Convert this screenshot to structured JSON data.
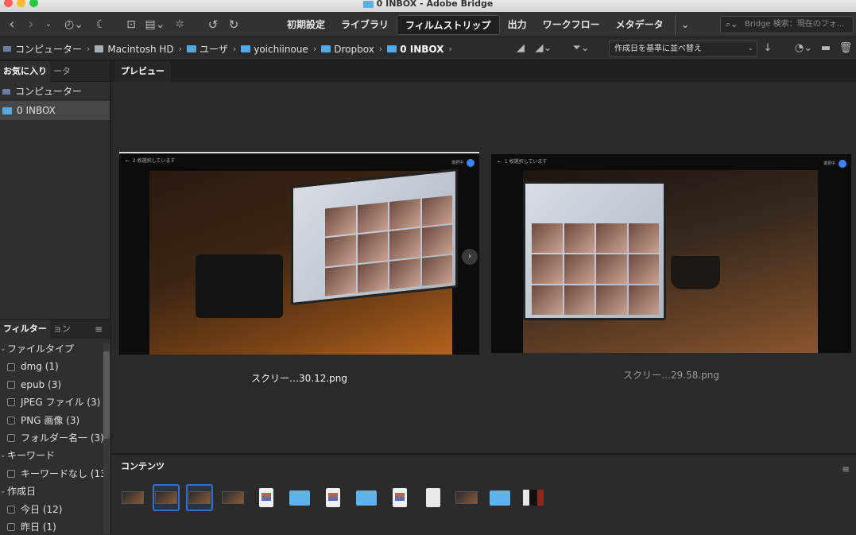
{
  "window": {
    "title": "0 INBOX - Adobe Bridge"
  },
  "toolbar": {
    "workspaces": [
      "初期設定",
      "ライブラリ",
      "フィルムストリップ",
      "出力",
      "ワークフロー",
      "メタデータ"
    ],
    "active_workspace": "フィルムストリップ",
    "search_placeholder": "Bridge 検索：現在のフォ..."
  },
  "path": {
    "items": [
      "コンピューター",
      "Macintosh HD",
      "ユーザ",
      "yoichiinoue",
      "Dropbox",
      "0 INBOX"
    ],
    "sort_label": "作成日を基準に並べ替え"
  },
  "left_panel": {
    "tabs": [
      "お気に入り",
      "ータ"
    ],
    "favorites": [
      {
        "label": "コンピューター",
        "icon": "computer-icon"
      },
      {
        "label": "0 INBOX",
        "icon": "folder-icon"
      }
    ],
    "filter_tabs": [
      "フィルター",
      "ョン"
    ],
    "filters": [
      {
        "type": "head",
        "label": "ファイルタイプ"
      },
      {
        "type": "item",
        "label": "dmg",
        "count": "(1)"
      },
      {
        "type": "item",
        "label": "epub",
        "count": "(3)"
      },
      {
        "type": "item",
        "label": "JPEG ファイル",
        "count": "(3)"
      },
      {
        "type": "item",
        "label": "PNG 画像",
        "count": "(3)"
      },
      {
        "type": "item",
        "label": "フォルダー名一",
        "count": "(3)"
      },
      {
        "type": "head",
        "label": "キーワード"
      },
      {
        "type": "item",
        "label": "キーワードなし",
        "count": "(13)"
      },
      {
        "type": "head",
        "label": "作成日"
      },
      {
        "type": "item",
        "label": "今日",
        "count": "(12)"
      },
      {
        "type": "item",
        "label": "昨日",
        "count": "(1)"
      }
    ]
  },
  "preview": {
    "tab": "プレビュー",
    "images": [
      {
        "caption": "スクリー…30.12.png",
        "overlay": "2 枚選択しています",
        "selected_label": "選択中"
      },
      {
        "caption": "スクリー…29.58.png",
        "overlay": "1 枚選択しています",
        "selected_label": "選択中"
      }
    ]
  },
  "content": {
    "tab": "コンテンツ",
    "thumbnails": [
      "image",
      "image",
      "image",
      "image",
      "doc",
      "folder",
      "doc",
      "folder",
      "doc",
      "file",
      "image",
      "folder",
      "dark"
    ],
    "selected_indices": [
      1,
      2
    ]
  }
}
